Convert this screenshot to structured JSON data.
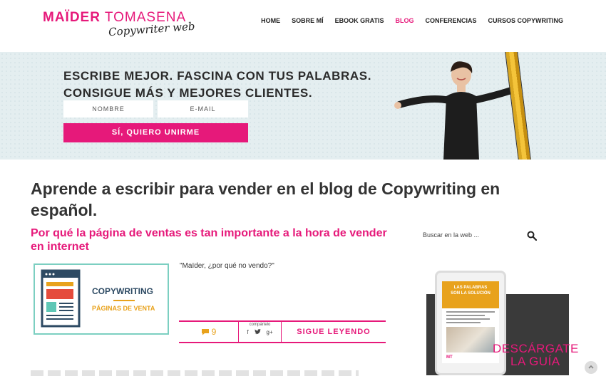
{
  "header": {
    "logo_name_bold": "MAÏDER",
    "logo_name_light": "TOMASENA",
    "logo_sub": "Copywriter web",
    "nav": [
      {
        "label": "HOME",
        "active": false
      },
      {
        "label": "SOBRE MÍ",
        "active": false
      },
      {
        "label": "EBOOK GRATIS",
        "active": false
      },
      {
        "label": "BLOG",
        "active": true
      },
      {
        "label": "CONFERENCIAS",
        "active": false
      },
      {
        "label": "CURSOS COPYWRITING",
        "active": false
      }
    ]
  },
  "hero": {
    "line1": "ESCRIBE MEJOR. FASCINA CON TUS PALABRAS.",
    "line2": "CONSIGUE MÁS Y MEJORES CLIENTES.",
    "name_placeholder": "NOMBRE",
    "email_placeholder": "E-MAIL",
    "cta_label": "SÍ, QUIERO UNIRME"
  },
  "main": {
    "page_title": "Aprende a escribir para vender en el blog de Copywriting en español.",
    "post": {
      "title": "Por qué la página de ventas es tan importante a la hora de vender en internet",
      "thumb_line1": "COPYWRITING",
      "thumb_line2": "PÁGINAS DE VENTA",
      "excerpt": "\"Maïder, ¿por qué no vendo?\"",
      "comments_count": "9",
      "share_label": "compártelo",
      "share_icons": [
        "f",
        "t",
        "g+"
      ],
      "read_more": "SIGUE LEYENDO"
    }
  },
  "sidebar": {
    "search_placeholder": "Buscar en la web ...",
    "promo": {
      "tablet_title_1": "LAS PALABRAS",
      "tablet_title_2": "SON LA SOLUCIÓN",
      "tablet_mark": "MT",
      "cta_line1": "DESCÁRGATE",
      "cta_line2": "LA GUÍA"
    }
  },
  "colors": {
    "accent": "#e6197a",
    "hero_bg": "#e4eef0",
    "teal": "#7ccfc1",
    "amber": "#e8a21c",
    "dark": "#3a3a3a"
  }
}
